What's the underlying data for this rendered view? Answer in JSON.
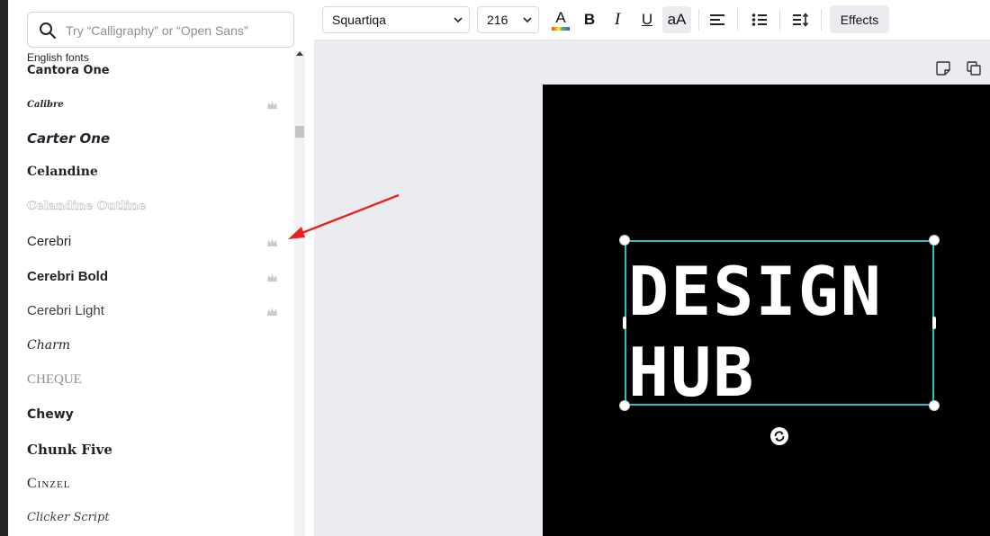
{
  "search": {
    "placeholder": "Try “Calligraphy” or “Open Sans”"
  },
  "font_list": {
    "section_label": "English fonts",
    "fonts": [
      {
        "name": "Cantora One",
        "premium": false
      },
      {
        "name": "Calibre",
        "premium": true
      },
      {
        "name": "Carter One",
        "premium": false
      },
      {
        "name": "Celandine",
        "premium": false
      },
      {
        "name": "Celandine Outline",
        "premium": false
      },
      {
        "name": "Cerebri",
        "premium": true
      },
      {
        "name": "Cerebri Bold",
        "premium": true
      },
      {
        "name": "Cerebri Light",
        "premium": true
      },
      {
        "name": "Charm",
        "premium": false
      },
      {
        "name": "CHEQUE",
        "premium": false
      },
      {
        "name": "Chewy",
        "premium": false
      },
      {
        "name": "Chunk Five",
        "premium": false
      },
      {
        "name": "Cinzel",
        "premium": false
      },
      {
        "name": "Clicker Script",
        "premium": false
      }
    ]
  },
  "toolbar": {
    "font_family": "Squartiqa",
    "font_size": "216",
    "text_color_label": "A",
    "bold_label": "B",
    "italic_label": "I",
    "underline_label": "U",
    "case_label": "aA",
    "effects_label": "Effects"
  },
  "canvas": {
    "text_line1": "DESIGN",
    "text_line2": "HUB",
    "background_color": "#000000",
    "selection_color": "#22c3c6"
  },
  "annotation": {
    "arrow_color": "#e8231f"
  }
}
